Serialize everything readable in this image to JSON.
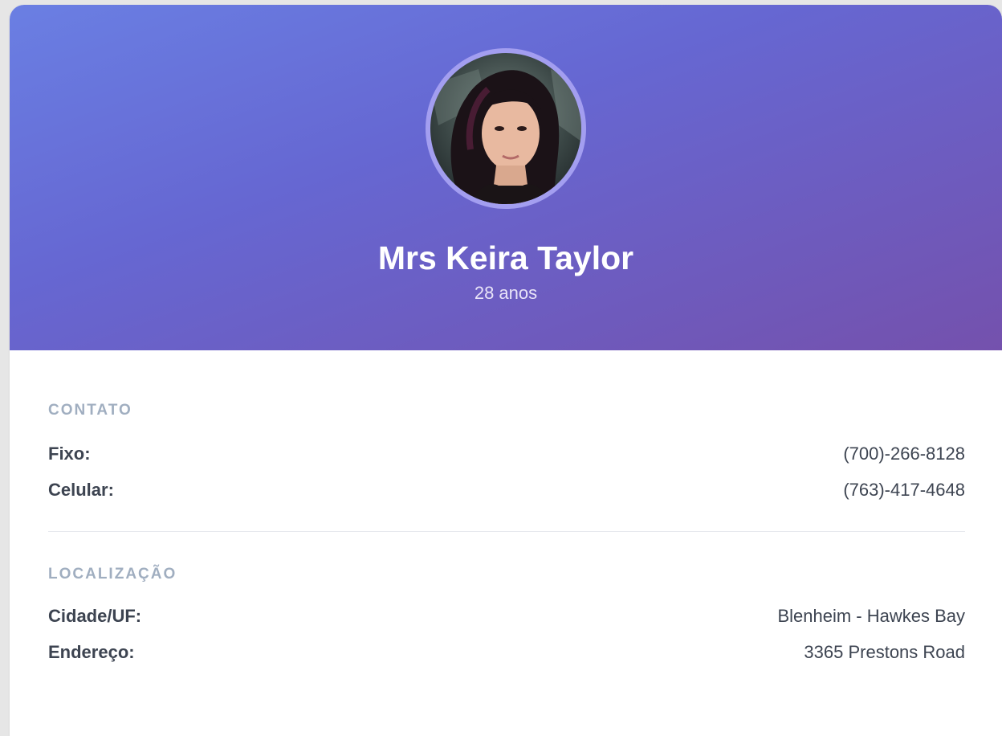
{
  "profile": {
    "name": "Mrs Keira Taylor",
    "age": "28 anos",
    "avatar": "profile-photo"
  },
  "contact": {
    "title": "CONTATO",
    "rows": [
      {
        "label": "Fixo:",
        "value": "(700)-266-8128"
      },
      {
        "label": "Celular:",
        "value": "(763)-417-4648"
      }
    ]
  },
  "location": {
    "title": "LOCALIZAÇÃO",
    "rows": [
      {
        "label": "Cidade/UF:",
        "value": "Blenheim - Hawkes Bay"
      },
      {
        "label": "Endereço:",
        "value": "3365 Prestons Road"
      }
    ]
  },
  "colors": {
    "header_start": "#6a7fe3",
    "header_end": "#7451ad",
    "section_title": "#a0aec0",
    "text": "#3d4451"
  }
}
